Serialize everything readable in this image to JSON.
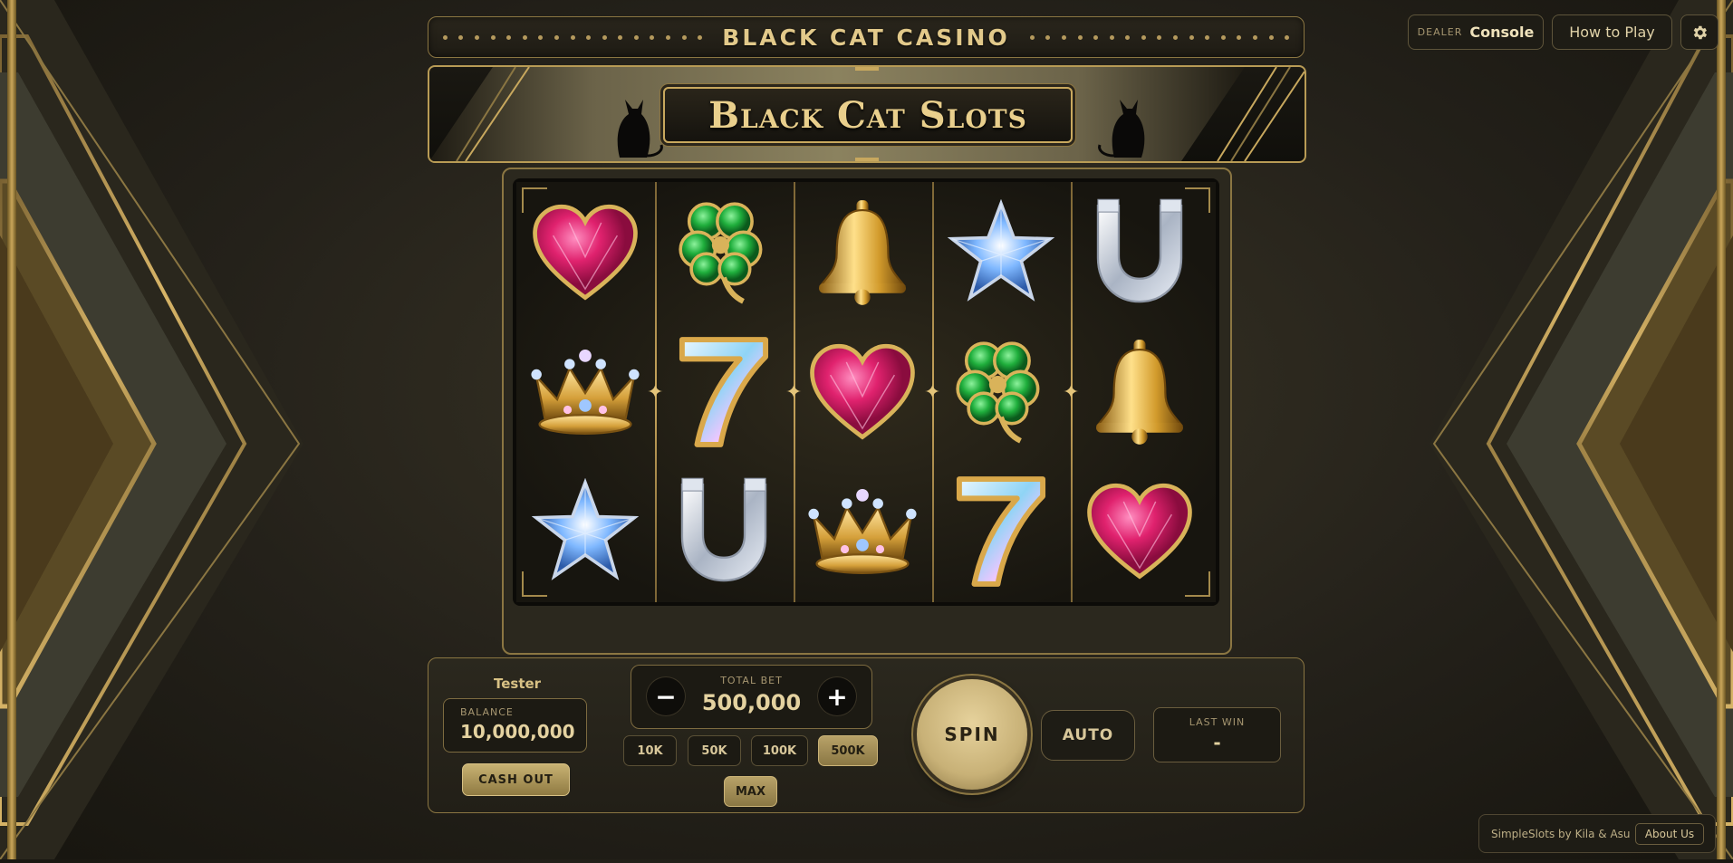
{
  "header": {
    "casino_title": "BLACK CAT CASINO",
    "slots_title": "Black Cat Slots"
  },
  "top_bar": {
    "dealer_prefix": "DEALER",
    "dealer_label": "Console",
    "how_to_play": "How to Play",
    "settings_icon": "gear-icon"
  },
  "grid": {
    "rows": [
      [
        "heart",
        "clover",
        "bell",
        "star",
        "horseshoe"
      ],
      [
        "crown",
        "seven",
        "heart",
        "clover",
        "bell"
      ],
      [
        "star",
        "horseshoe",
        "crown",
        "seven",
        "heart"
      ]
    ]
  },
  "player": {
    "name": "Tester",
    "balance_label": "BALANCE",
    "balance": "10,000,000",
    "cash_out": "CASH OUT"
  },
  "bet": {
    "label": "TOTAL BET",
    "value": "500,000",
    "minus": "−",
    "plus": "+",
    "chips": [
      "10K",
      "50K",
      "100K",
      "500K"
    ],
    "selected_chip": "500K",
    "max": "MAX"
  },
  "controls": {
    "spin": "SPIN",
    "auto": "AUTO",
    "last_win_label": "LAST WIN",
    "last_win_value": "-"
  },
  "footer": {
    "credit": "SimpleSlots by Kila & Asu",
    "about": "About Us"
  },
  "colors": {
    "gold": "#c8a85e",
    "background": "#24211a",
    "heart": "#e0226e",
    "clover": "#1fae3c",
    "star": "#7fb8ff"
  }
}
